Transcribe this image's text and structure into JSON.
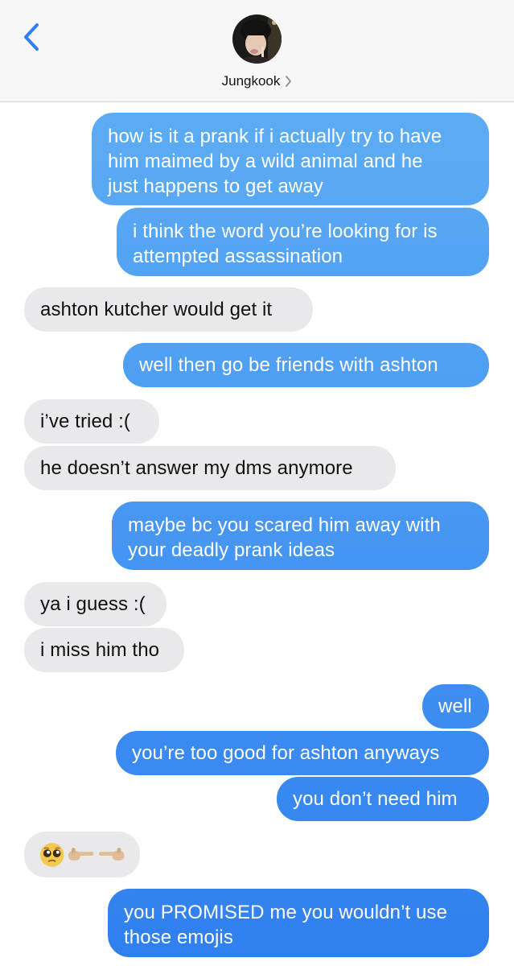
{
  "header": {
    "contact_name": "Jungkook"
  },
  "messages": [
    {
      "from": "me",
      "text": "how is it a prank if i actually try to have\nhim maimed by a wild animal and he\njust happens to get away"
    },
    {
      "from": "me",
      "text": "i think the word you’re looking for is\nattempted assassination"
    },
    {
      "from": "them",
      "text": "ashton kutcher would get it"
    },
    {
      "from": "me",
      "text": "well then go be friends with ashton"
    },
    {
      "from": "them",
      "text": "i’ve tried :("
    },
    {
      "from": "them",
      "text": "he doesn’t answer my dms anymore"
    },
    {
      "from": "me",
      "text": "maybe bc you scared him away with\nyour deadly prank ideas"
    },
    {
      "from": "them",
      "text": "ya i guess :("
    },
    {
      "from": "them",
      "text": "i miss him tho"
    },
    {
      "from": "me",
      "text": "well"
    },
    {
      "from": "me",
      "text": "you’re too good for ashton anyways"
    },
    {
      "from": "me",
      "text": "you don’t need him"
    },
    {
      "from": "them",
      "text": "",
      "emoji": [
        "pleading-face-icon",
        "pointing-right-icon",
        "pointing-left-icon"
      ]
    },
    {
      "from": "me",
      "text": "you PROMISED me you wouldn’t use\nthose emojis"
    }
  ],
  "colors": {
    "sent_top": "#62b2f5",
    "sent_bottom": "#2f7ff0",
    "received": "#e9e9eb",
    "header_bg": "#f7f7f8",
    "accent": "#2f7ff0"
  }
}
